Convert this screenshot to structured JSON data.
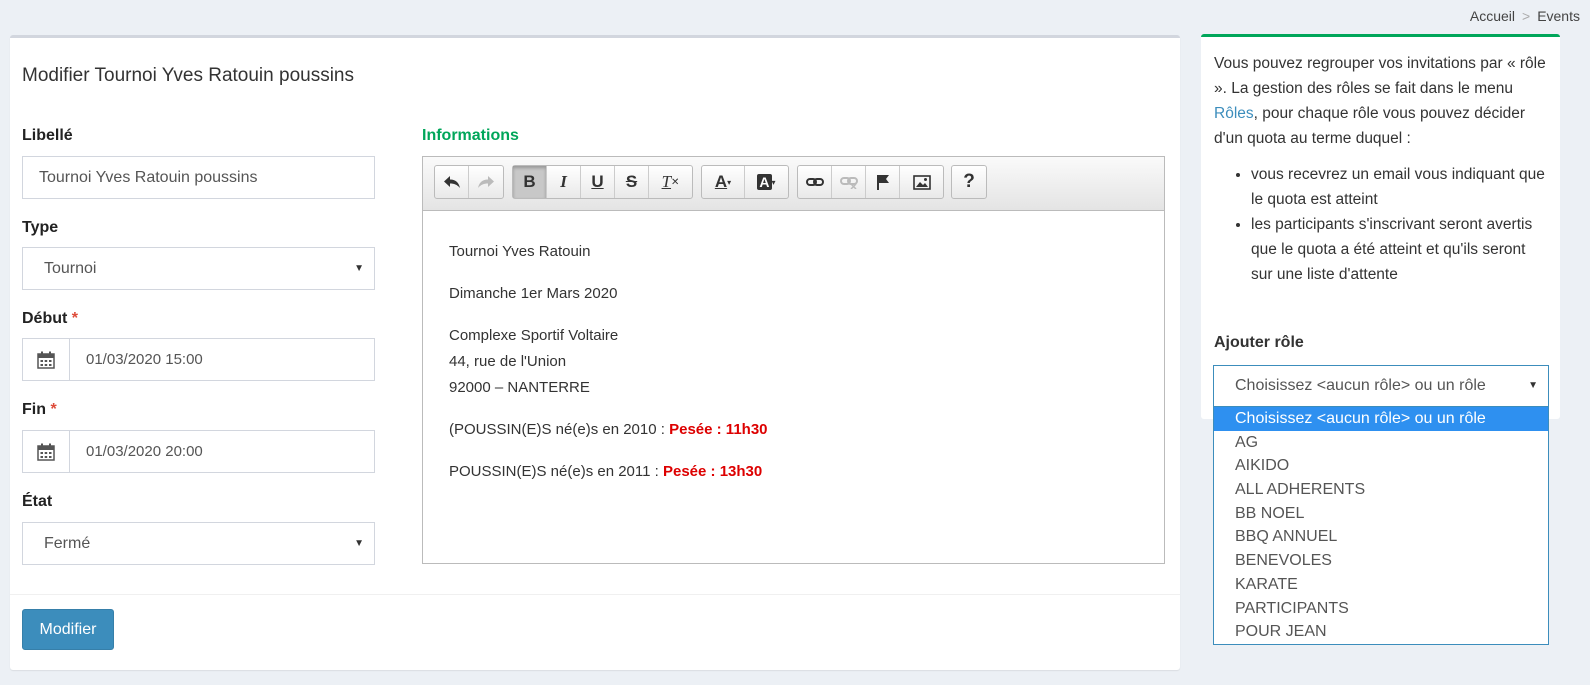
{
  "breadcrumb": {
    "home": "Accueil",
    "separator": ">",
    "current": "Events"
  },
  "form": {
    "title": "Modifier Tournoi Yves Ratouin poussins",
    "libelle_label": "Libellé",
    "libelle_value": "Tournoi Yves Ratouin poussins",
    "type_label": "Type",
    "type_value": "Tournoi",
    "debut_label": "Début",
    "debut_value": "01/03/2020 15:00",
    "fin_label": "Fin",
    "fin_value": "01/03/2020 20:00",
    "etat_label": "État",
    "etat_value": "Fermé",
    "required_mark": "*",
    "submit_label": "Modifier"
  },
  "editor": {
    "label": "Informations",
    "line1": "Tournoi Yves Ratouin",
    "line2": "Dimanche 1er Mars 2020",
    "address1": "Complexe Sportif Voltaire",
    "address2": "44, rue de l'Union",
    "address3": "92000 – NANTERRE",
    "poussin2010": "(POUSSIN(E)S né(e)s en 2010 : ",
    "pesee2010": "Pesée : 11h30",
    "poussin2011": "POUSSIN(E)S né(e)s en 2011 : ",
    "pesee2011": "Pesée : 13h30",
    "accent_red": "#dd0000"
  },
  "sidebar": {
    "intro_before_link": "Vous pouvez regrouper vos invitations par « rôle ». La gestion des rôles se fait dans le menu ",
    "link_text": "Rôles",
    "intro_after_link": ", pour chaque rôle vous pouvez décider d'un quota au terme duquel :",
    "bullets": [
      "vous recevrez un email vous indiquant que le quota est atteint",
      "les participants s'inscrivant seront avertis que le quota a été atteint et qu'ils seront sur une liste d'attente"
    ],
    "add_role_label": "Ajouter rôle",
    "select_value": "Choisissez <aucun rôle> ou un rôle",
    "options": [
      "Choisissez <aucun rôle> ou un rôle",
      "AG",
      "AIKIDO",
      "ALL ADHERENTS",
      "BB NOEL",
      "BBQ ANNUEL",
      "BENEVOLES",
      "KARATE",
      "PARTICIPANTS",
      "POUR JEAN"
    ]
  },
  "colors": {
    "primary": "#3c8dbc",
    "success": "#00a65a",
    "danger": "#dd4b39"
  }
}
